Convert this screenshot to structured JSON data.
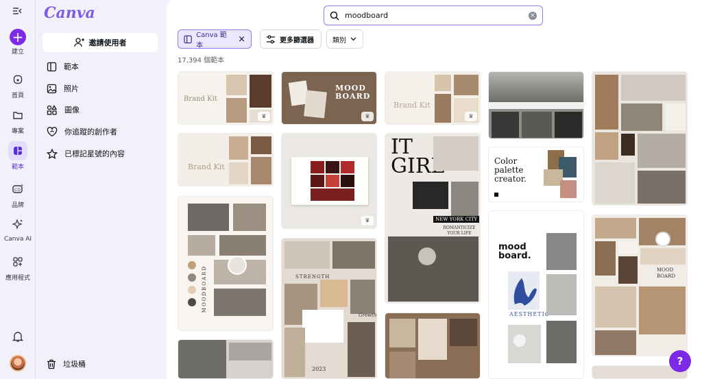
{
  "rail": {
    "create": "建立",
    "home": "首頁",
    "projects": "專案",
    "templates": "範本",
    "brand": "品牌",
    "canva_ai": "Canva AI",
    "apps": "應用程式"
  },
  "panel": {
    "logo": "Canva",
    "invite": "邀請使用者",
    "nav": [
      "範本",
      "照片",
      "圖像",
      "你追蹤的創作者",
      "已標記星號的內容"
    ],
    "trash": "垃圾桶"
  },
  "search": {
    "value": "moodboard"
  },
  "filters": {
    "canva_templates": "Canva 範本",
    "more_filters": "更多篩選器",
    "category": "類別"
  },
  "results_count": "17,394 個範本",
  "cards": {
    "brand_kit_1": "Brand Kit",
    "mood_board": "MOOD BOARD",
    "brand_kit_2": "Brand Kit",
    "brand_kit_3": "Brand Kit",
    "it_girl": "IT GIRL",
    "color_palette": "Color palette creator.",
    "moodboard_vertical": "MOODBOARD",
    "strength": "STRENGTH",
    "growth": "Growth",
    "new_york_city": "NEW YORK CITY",
    "romanticize": "ROMANTICIZE YOUR LIFE",
    "moodboard_dot": "mood board.",
    "aesthetic": "AESTHETIC",
    "mood_board_small": "MOOD BOARD",
    "year": "2023"
  },
  "help": "?",
  "colors": {
    "accent": "#7d2ae8",
    "active_bg": "#e4dcfb"
  }
}
